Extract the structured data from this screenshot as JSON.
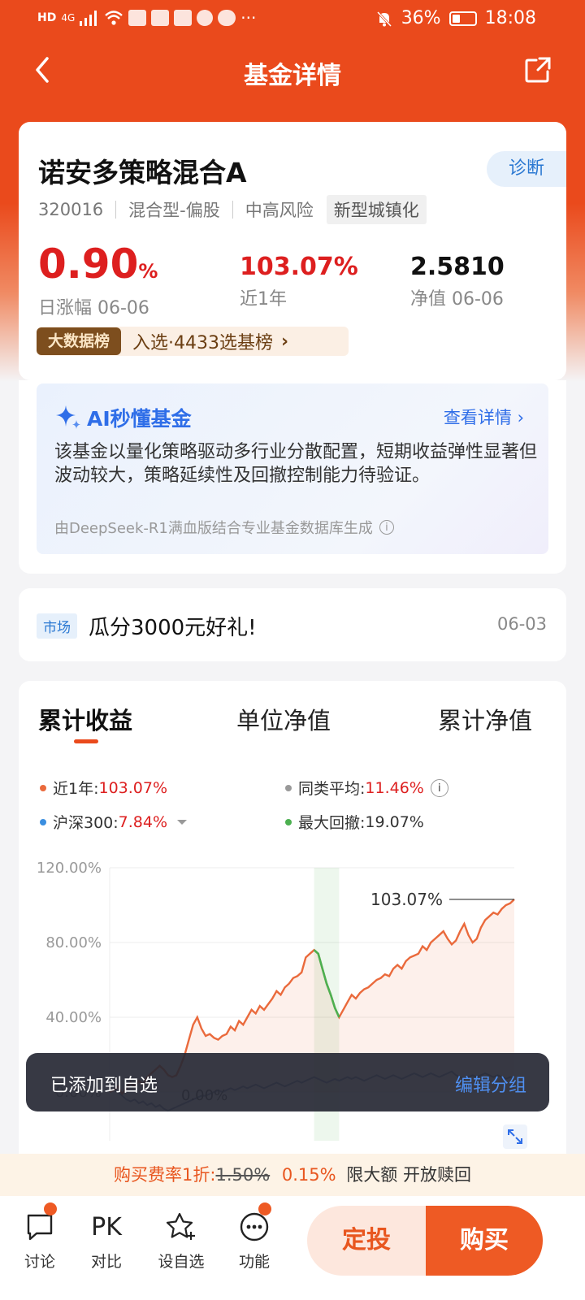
{
  "status_bar": {
    "time": "18:08",
    "battery": "36%",
    "battery_level": 0.36,
    "network": "4G",
    "more": "···"
  },
  "header": {
    "title": "基金详情"
  },
  "fund": {
    "name": "诺安多策略混合A",
    "diagnose_label": "诊断",
    "code": "320016",
    "type": "混合型-偏股",
    "risk": "中高风险",
    "theme_tag": "新型城镇化",
    "daily_change_value": "0.90",
    "daily_change_unit": "%",
    "daily_change_label": "日涨幅 06-06",
    "year_return_value": "103.07%",
    "year_return_label": "近1年",
    "nav_value": "2.5810",
    "nav_label": "净值 06-06",
    "rank_badge": "大数据榜",
    "rank_text": "入选·4433选基榜",
    "rank_chevron": "›"
  },
  "ai": {
    "title": "AI秒懂基金",
    "more_label": "查看详情 ›",
    "summary": "该基金以量化策略驱动多行业分散配置，短期收益弹性显著但波动较大，策略延续性及回撤控制能力待验证。",
    "footer": "由DeepSeek-R1满血版结合专业基金数据库生成",
    "info_glyph": "i"
  },
  "news": {
    "tag": "市场",
    "title": "瓜分3000元好礼!",
    "date": "06-03"
  },
  "chart_tabs": [
    "累计收益",
    "单位净值",
    "累计净值"
  ],
  "legend": {
    "fund_label": "近1年:",
    "fund_value": "103.07%",
    "peer_label": "同类平均:",
    "peer_value": "11.46%",
    "index_label": "沪深300:",
    "index_value": "7.84%",
    "drawdown_label": "最大回撤:",
    "drawdown_value": "19.07%"
  },
  "chart_data": {
    "type": "line",
    "ylim": [
      0,
      120
    ],
    "y_ticks": [
      "120.00%",
      "80.00%",
      "40.00%",
      "0.00%"
    ],
    "end_label": "103.07%",
    "zero_label": "0.00%",
    "series": [
      {
        "name": "近1年",
        "color": "#ea6a3c",
        "values": [
          0,
          1,
          3,
          -1,
          2,
          5,
          3,
          6,
          4,
          8,
          10,
          12,
          14,
          12,
          9,
          8,
          9,
          14,
          20,
          28,
          36,
          40,
          34,
          30,
          31,
          29,
          28,
          30,
          31,
          35,
          33,
          38,
          36,
          40,
          44,
          42,
          46,
          44,
          47,
          50,
          54,
          52,
          56,
          58,
          61,
          62,
          64,
          72,
          74,
          76,
          74,
          66,
          58,
          52,
          45,
          40,
          44,
          48,
          52,
          50,
          53,
          55,
          56,
          58,
          60,
          61,
          63,
          62,
          66,
          68,
          66,
          70,
          72,
          73,
          74,
          78,
          76,
          80,
          82,
          84,
          86,
          82,
          79,
          81,
          86,
          90,
          84,
          80,
          82,
          88,
          92,
          94,
          96,
          95,
          98,
          100,
          101,
          103.07
        ]
      },
      {
        "name": "沪深300",
        "color": "#7d8fb0",
        "values": [
          0,
          1,
          0,
          -2,
          -4,
          -5,
          -4,
          -6,
          -5,
          -7,
          -6,
          -8,
          -7,
          -9,
          -10,
          -9,
          -8,
          -7,
          -6,
          -5,
          -4,
          -3,
          -2,
          -2,
          -1,
          0,
          1,
          0,
          1,
          2,
          1,
          2,
          3,
          2,
          3,
          4,
          3,
          2,
          3,
          4,
          5,
          4,
          3,
          4,
          5,
          6,
          5,
          6,
          7,
          8,
          7,
          6,
          5,
          6,
          7,
          6,
          7,
          8,
          7,
          8,
          7,
          6,
          7,
          8,
          9,
          8,
          7,
          8,
          9,
          8,
          7,
          8,
          9,
          10,
          9,
          8,
          9,
          10,
          9,
          8,
          9,
          10,
          11,
          9,
          8,
          7,
          8,
          9,
          8,
          9,
          10,
          9,
          8,
          9,
          8,
          7,
          8,
          7.84
        ]
      }
    ]
  },
  "toast": {
    "message": "已添加到自选",
    "action": "编辑分组"
  },
  "fee": {
    "prefix": "购买费率1折:",
    "original": "1.50%",
    "current": "0.15%",
    "suffix": "限大额 开放赎回"
  },
  "bottom_bar": {
    "discuss": "讨论",
    "pk_text": "PK",
    "pk": "对比",
    "watch": "设自选",
    "func": "功能",
    "auto_invest": "定投",
    "buy": "购买"
  }
}
